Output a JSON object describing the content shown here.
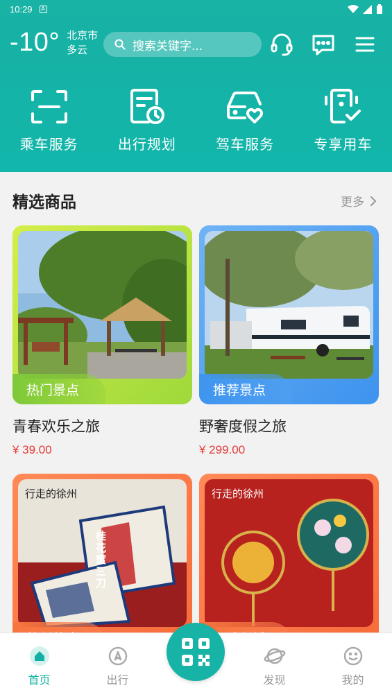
{
  "status_bar": {
    "time": "10:29",
    "notification_icon": "A"
  },
  "weather": {
    "temperature": "-10°",
    "city": "北京市",
    "condition": "多云"
  },
  "search": {
    "placeholder": "搜索关键字..."
  },
  "header_icons": [
    "headset-icon",
    "message-icon",
    "menu-icon"
  ],
  "services": [
    {
      "label": "乘车服务",
      "icon": "scan-frame-icon"
    },
    {
      "label": "出行规划",
      "icon": "calendar-clock-icon"
    },
    {
      "label": "驾车服务",
      "icon": "car-heart-icon"
    },
    {
      "label": "专享用车",
      "icon": "phone-check-icon"
    }
  ],
  "featured": {
    "title": "精选商品",
    "more_label": "更多",
    "items": [
      {
        "tag": "热门景点",
        "name": "青春欢乐之旅",
        "price": "¥ 39.00"
      },
      {
        "tag": "推荐景点",
        "name": "野奢度假之旅",
        "price": "¥ 299.00"
      },
      {
        "tag": "徐州故事",
        "name": "",
        "price": "",
        "brand_text": "行走的徐州",
        "product_text": "桂花蜜三刀"
      },
      {
        "tag": "风雅彭城",
        "name": "",
        "price": "",
        "brand_text": "行走的徐州"
      }
    ]
  },
  "colors": {
    "primary": "#12b0a4",
    "price": "#e53935"
  },
  "bottom_nav": {
    "items": [
      {
        "label": "首页",
        "icon": "home-icon",
        "active": true
      },
      {
        "label": "出行",
        "icon": "compass-icon",
        "active": false
      },
      {
        "label": "发现",
        "icon": "planet-icon",
        "active": false
      },
      {
        "label": "我的",
        "icon": "smile-icon",
        "active": false
      }
    ],
    "center_icon": "qr-code-icon"
  }
}
